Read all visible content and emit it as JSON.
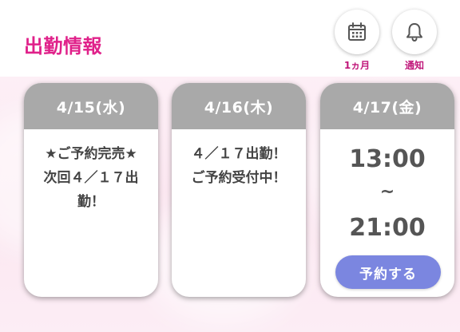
{
  "header": {
    "title": "出勤情報",
    "title_color": "#e0218a",
    "buttons": [
      {
        "icon": "calendar-icon",
        "label": "1ヵ月"
      },
      {
        "icon": "bell-icon",
        "label": "通知"
      }
    ]
  },
  "schedule": [
    {
      "date": "4/15(水)",
      "message": "★ご予約完売★\n次回４／１７出\n勤！"
    },
    {
      "date": "4/16(木)",
      "message": "４／１７出勤！\nご予約受付中！"
    },
    {
      "date": "4/17(金)",
      "start": "13:00",
      "separator": "~",
      "end": "21:00",
      "button_label": "予約する"
    }
  ],
  "colors": {
    "card_header": "#a9a9a9",
    "reserve_button": "#7b86e0",
    "background_tint": "#fdeff6"
  }
}
